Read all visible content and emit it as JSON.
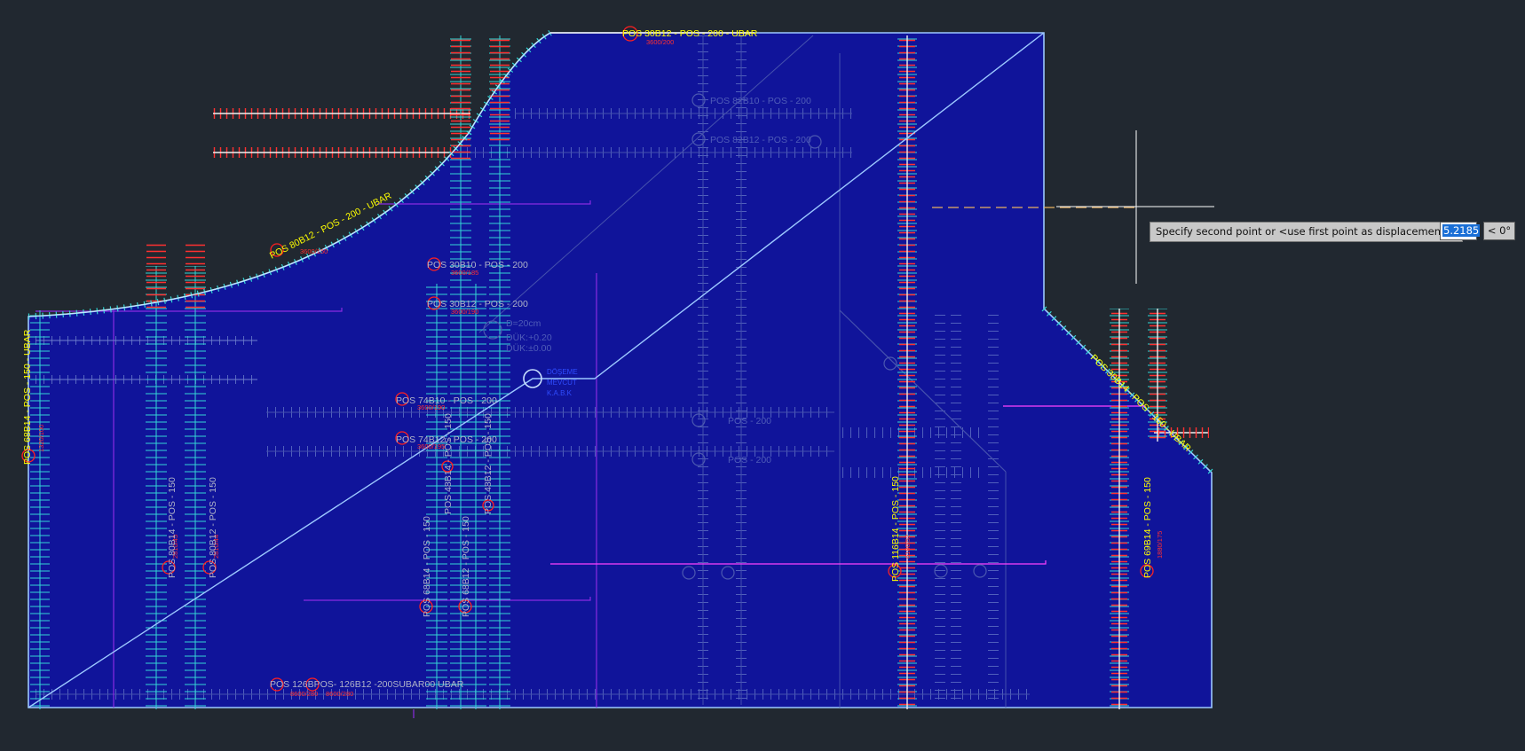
{
  "command_prompt": {
    "message": "Specify second point or <use first point as displacement>:",
    "distance_value": "5.2185",
    "angle_value": "< 0°"
  },
  "labels": {
    "top_ubar": "POS 30B12 - POS - 200 - UBAR",
    "curve_ubar": "POS 80B12 - POS - 200 - UBAR",
    "left_ubar": "POS 68B14 - POS - 150 - UBAR",
    "pos_30b10": "POS 30B10 - POS - 200",
    "pos_30b12": "POS 30B12 - POS - 200",
    "pos_74b10": "POS 74B10 - POS - 200",
    "pos_74b12": "POS 74B12 - POS - 200",
    "bottom_ubar": "POS 126BPOS- 126B12 -200SUBAR00 UBAR",
    "v_80b14": "POS 80B14 - POS - 150",
    "v_80b12": "POS 80B12 - POS - 150",
    "v_68b14": "POS 68B14 - POS - 150",
    "v_48b14": "POS 48B14 - POS - 150",
    "v_68b12": "POS 68B12 - POS - 150",
    "v_48b12": "POS 48B12 - POS - 150",
    "v_116b14": "POS 116B14 - POS - 150",
    "v_69b14": "POS 69B14 - POS - 150",
    "right_ubar": "POS 30B14 - POS - 150 - UBAR",
    "ghost_82b10": "POS 82B10 - POS - 200",
    "ghost_82b12": "POS 82B12 - POS - 200",
    "ghost_pos200a": "POS - 200",
    "ghost_pos200b": "POS - 200",
    "note_d": "D=20cm",
    "note_duk1": "DÜK:+0.20",
    "note_duk2": "DÜK:±0.00"
  },
  "colors": {
    "background": "#212830",
    "slab_fill": "#10149a",
    "outline": "#9cc8ff",
    "rebar_label": "#ffff00",
    "tick_cyan": "#33d6d6",
    "tick_red": "#ff3030",
    "magenta": "#ff40ff",
    "purple": "#8a2be2"
  }
}
